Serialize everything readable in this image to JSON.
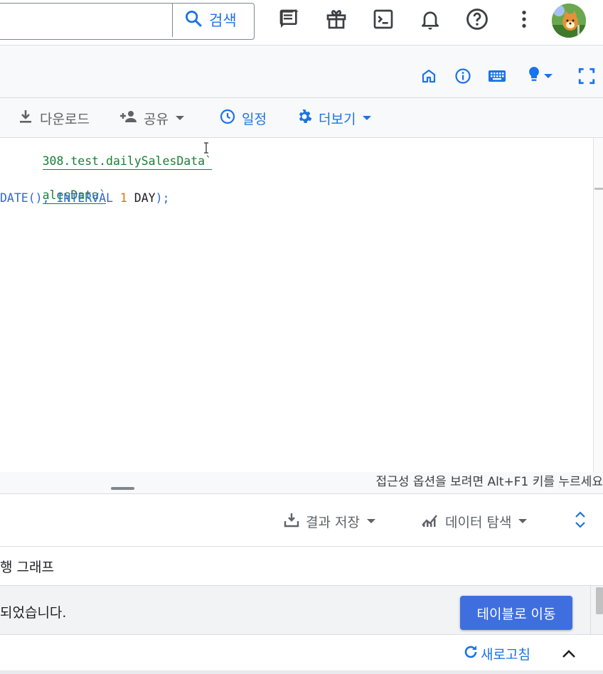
{
  "search": {
    "button_label": "검색",
    "value": ""
  },
  "icons": {
    "search": "search-icon",
    "feedback": "feedback-icon",
    "gift": "gift-icon",
    "terminal": "terminal-icon",
    "notifications": "bell-icon",
    "help": "help-icon",
    "more": "more-vert-icon",
    "home": "home-icon",
    "info": "info-icon",
    "keyboard": "keyboard-icon",
    "idea": "lightbulb-icon",
    "fullscreen": "fullscreen-icon"
  },
  "editor_toolbar": {
    "download": "다운로드",
    "share": "공유",
    "schedule": "일정",
    "more": "더보기"
  },
  "editor": {
    "line1_str": "308.test.dailySalesData`",
    "line3_str": "alesData`",
    "line4_fn": "DATE",
    "line4_paren_open": "(), ",
    "line4_kw": "INTERVAL",
    "line4_num": "1",
    "line4_unit": "DAY",
    "line4_end": ");"
  },
  "accessibility_hint": "접근성 옵션을 보려면 Alt+F1 키를 누르세요",
  "results": {
    "save_results": "결과 저장",
    "explore_data": "데이터 탐색",
    "tab_partial": "행 그래프",
    "notice_text": "되었습니다.",
    "goto_table": "테이블로 이동",
    "refresh": "새로고침"
  },
  "colors": {
    "accent": "#1a73e8",
    "button": "#3f6fdf",
    "string": "#188038",
    "keyword": "#3367d6",
    "number": "#e37400"
  }
}
